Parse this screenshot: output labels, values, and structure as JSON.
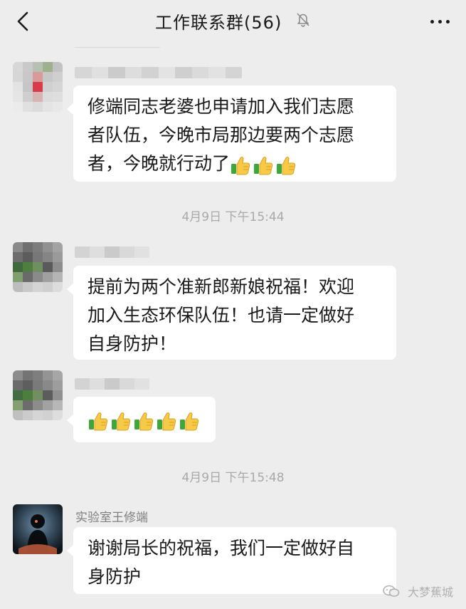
{
  "header": {
    "title": "工作联系群(56)"
  },
  "messages": {
    "m1": {
      "text_line1": "修端同志老婆也申请加入我们志愿",
      "text_line2": "者队伍，今晚市局那边要两个志愿",
      "text_line3": "者，今晚就行动了",
      "emoji_count": 3
    },
    "ts1": "4月9日 下午15:44",
    "m2": {
      "text_line1": "提前为两个准新郎新娘祝福！欢迎",
      "text_line2": "加入生态环保队伍！也请一定做好",
      "text_line3": "自身防护！"
    },
    "m3": {
      "emoji_count": 5
    },
    "ts2": "4月9日 下午15:48",
    "m4": {
      "sender": "实验室王修端",
      "text_line1": "谢谢局长的祝福，我们一定做好自",
      "text_line2": "身防护"
    }
  },
  "watermark": {
    "text": "大梦蕉城"
  },
  "icons": {
    "back": "chevron-left-icon",
    "mute": "bell-off-icon",
    "more": "more-dots-icon",
    "emoji": "thumbs-up-emoji"
  },
  "colors": {
    "background": "#ededed",
    "bubble": "#ffffff",
    "timestamp": "#a9a9a9"
  }
}
